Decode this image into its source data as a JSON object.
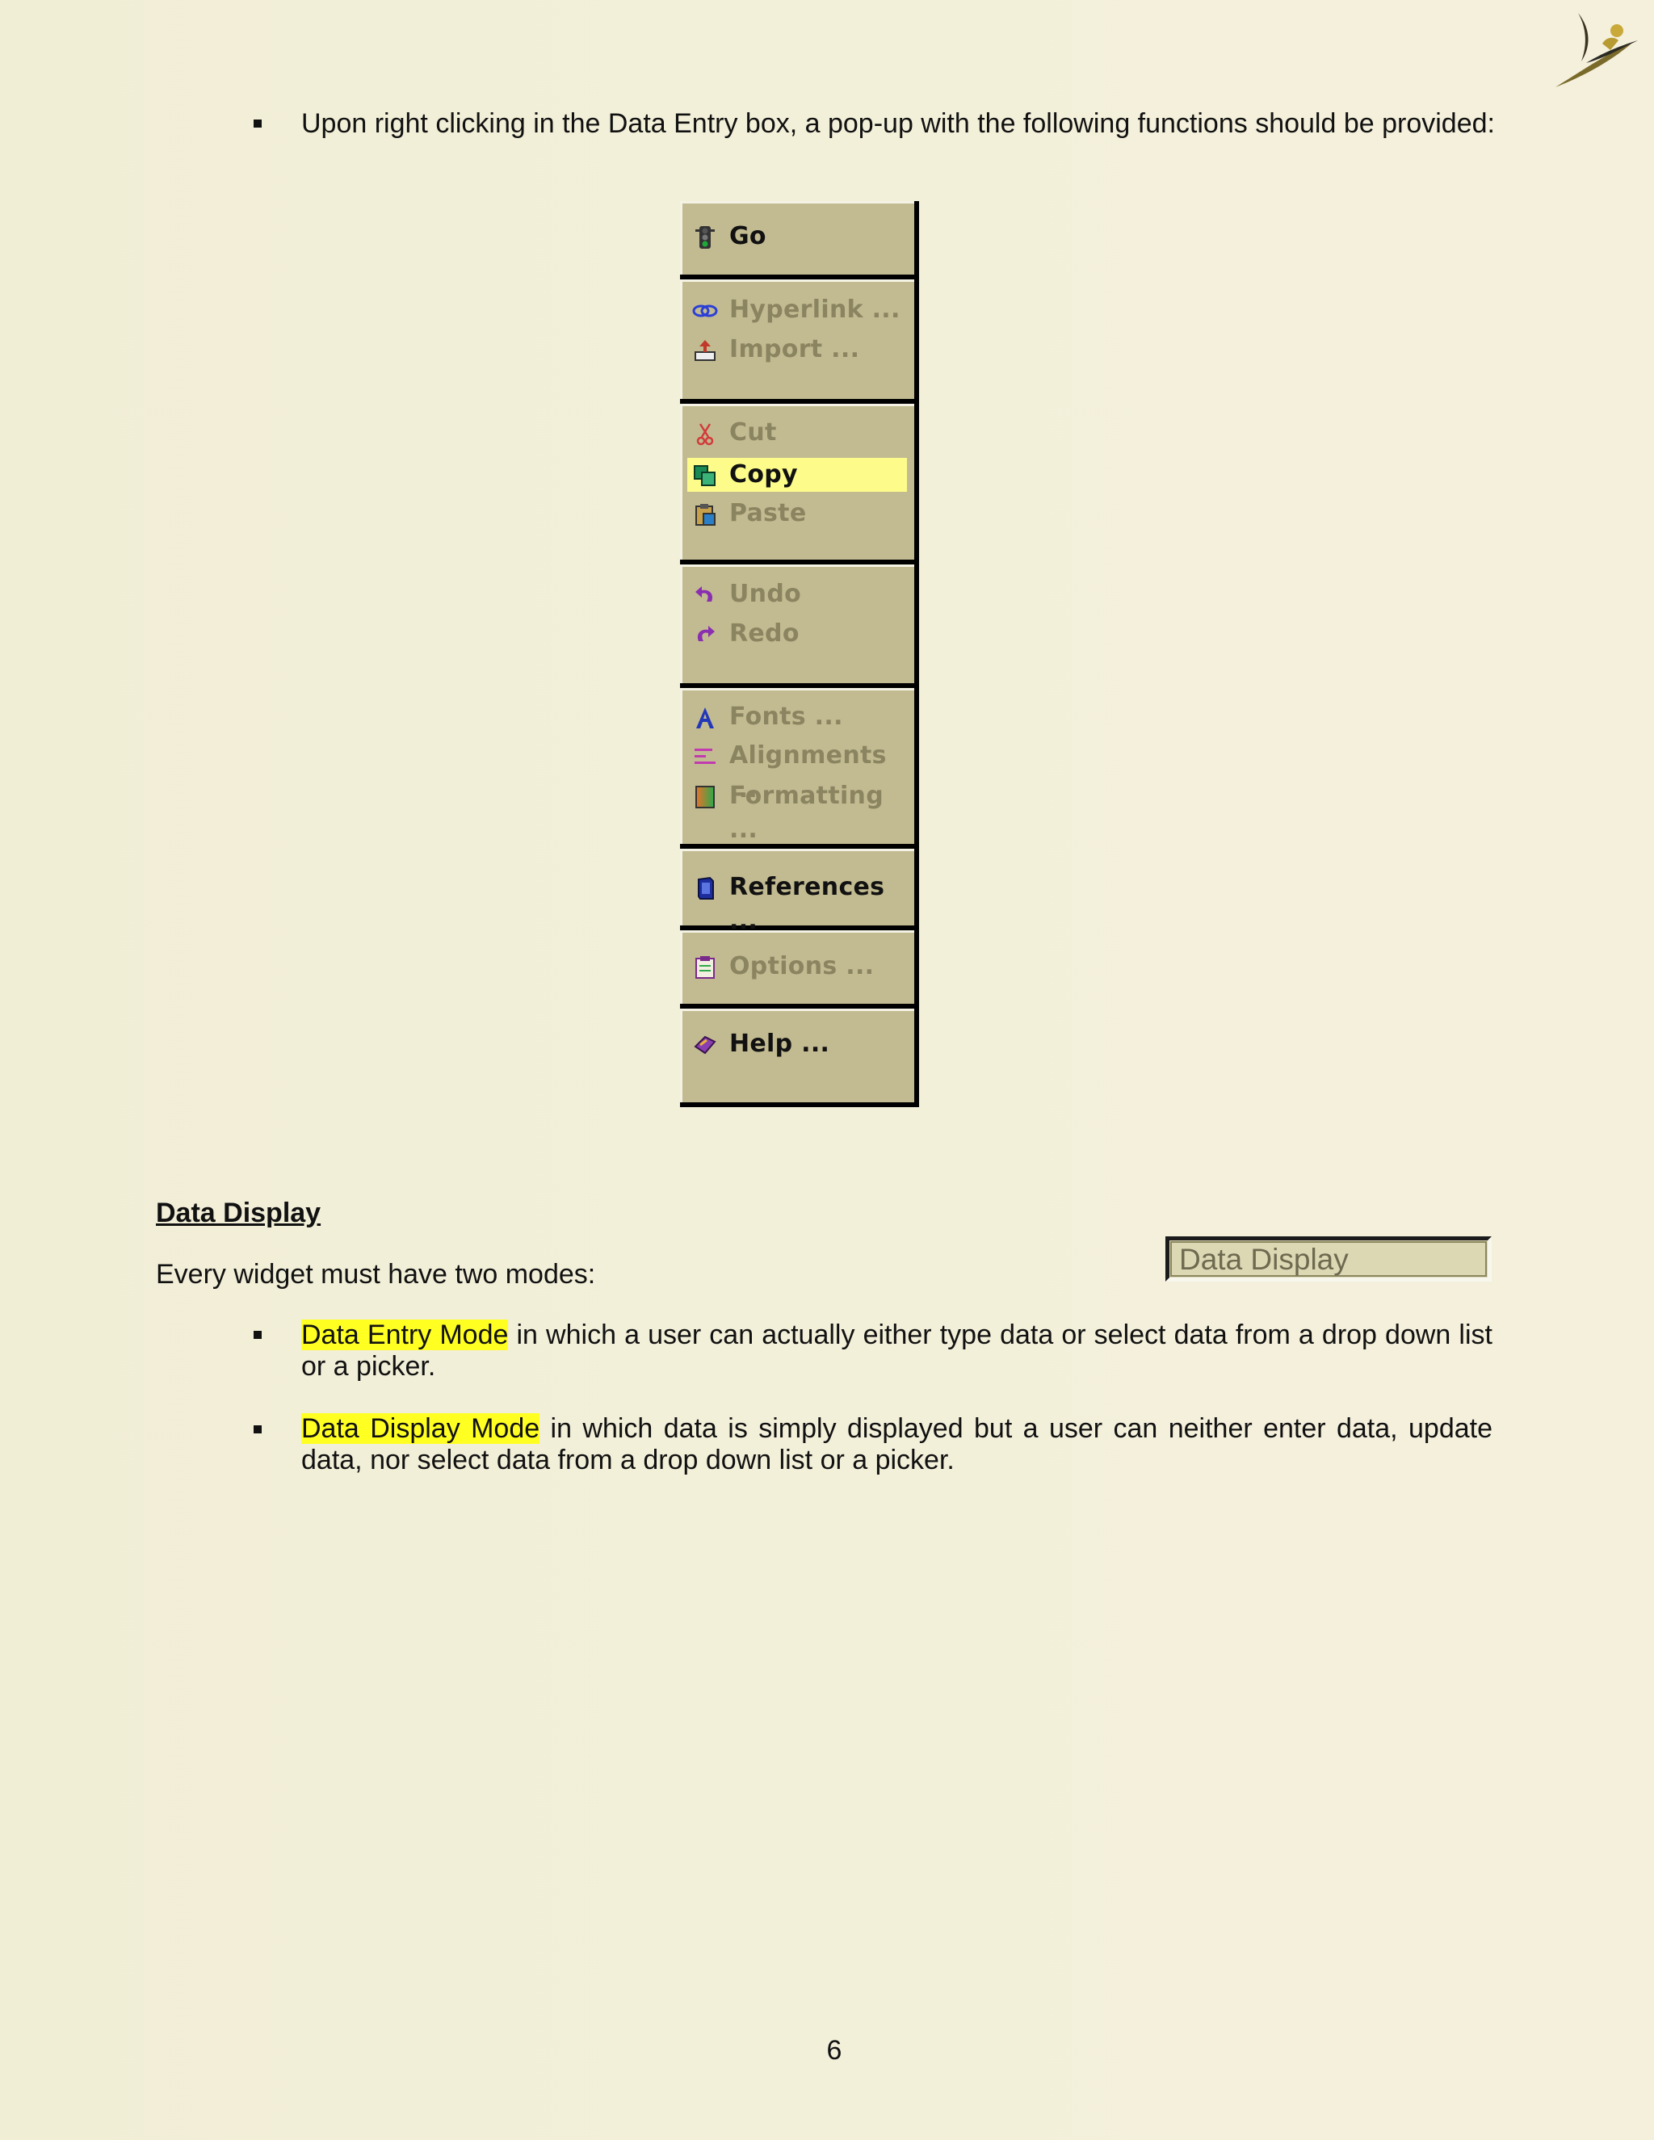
{
  "intro_bullet": "Upon right clicking in the Data Entry box, a pop-up with the following functions should be provided:",
  "menu": {
    "groups": [
      {
        "items": [
          {
            "label": "Go",
            "icon": "traffic-light-icon",
            "state": "enabled"
          }
        ]
      },
      {
        "items": [
          {
            "label": "Hyperlink ...",
            "icon": "chain-link-icon",
            "state": "disabled"
          },
          {
            "label": "Import ...",
            "icon": "import-tray-icon",
            "state": "disabled"
          }
        ]
      },
      {
        "items": [
          {
            "label": "Cut",
            "icon": "scissors-icon",
            "state": "disabled"
          },
          {
            "label": "Copy",
            "icon": "copy-icon",
            "state": "highlighted"
          },
          {
            "label": "Paste",
            "icon": "clipboard-icon",
            "state": "disabled"
          }
        ]
      },
      {
        "items": [
          {
            "label": "Undo",
            "icon": "undo-icon",
            "state": "disabled"
          },
          {
            "label": "Redo",
            "icon": "redo-icon",
            "state": "disabled"
          }
        ]
      },
      {
        "items": [
          {
            "label": "Fonts ...",
            "icon": "font-icon",
            "state": "disabled"
          },
          {
            "label": "Alignments ...",
            "icon": "align-icon",
            "state": "disabled"
          },
          {
            "label": "Formatting ...",
            "icon": "formatting-icon",
            "state": "disabled"
          }
        ]
      },
      {
        "items": [
          {
            "label": "References ...",
            "icon": "book-icon",
            "state": "enabled"
          }
        ]
      },
      {
        "items": [
          {
            "label": "Options ...",
            "icon": "options-icon",
            "state": "disabled"
          }
        ]
      },
      {
        "items": [
          {
            "label": "Help ...",
            "icon": "help-book-icon",
            "state": "enabled"
          }
        ]
      }
    ]
  },
  "section": {
    "title": "Data Display",
    "intro": "Every widget must have two modes:",
    "sample_box": "Data Display",
    "modes": [
      {
        "term": "Data Entry Mode",
        "rest": " in which a user can actually either type data or select data from a drop down list or a picker."
      },
      {
        "term": "Data Display Mode",
        "rest": " in which data is simply displayed but a user can neither enter data, update data, nor select data from a drop down list or a picker."
      }
    ]
  },
  "page_number": "6",
  "colors": {
    "menu_bg": "#c2bb91",
    "highlight": "#fdfc8a",
    "text_highlight": "#ffff22",
    "disabled_text": "#8b8460"
  }
}
